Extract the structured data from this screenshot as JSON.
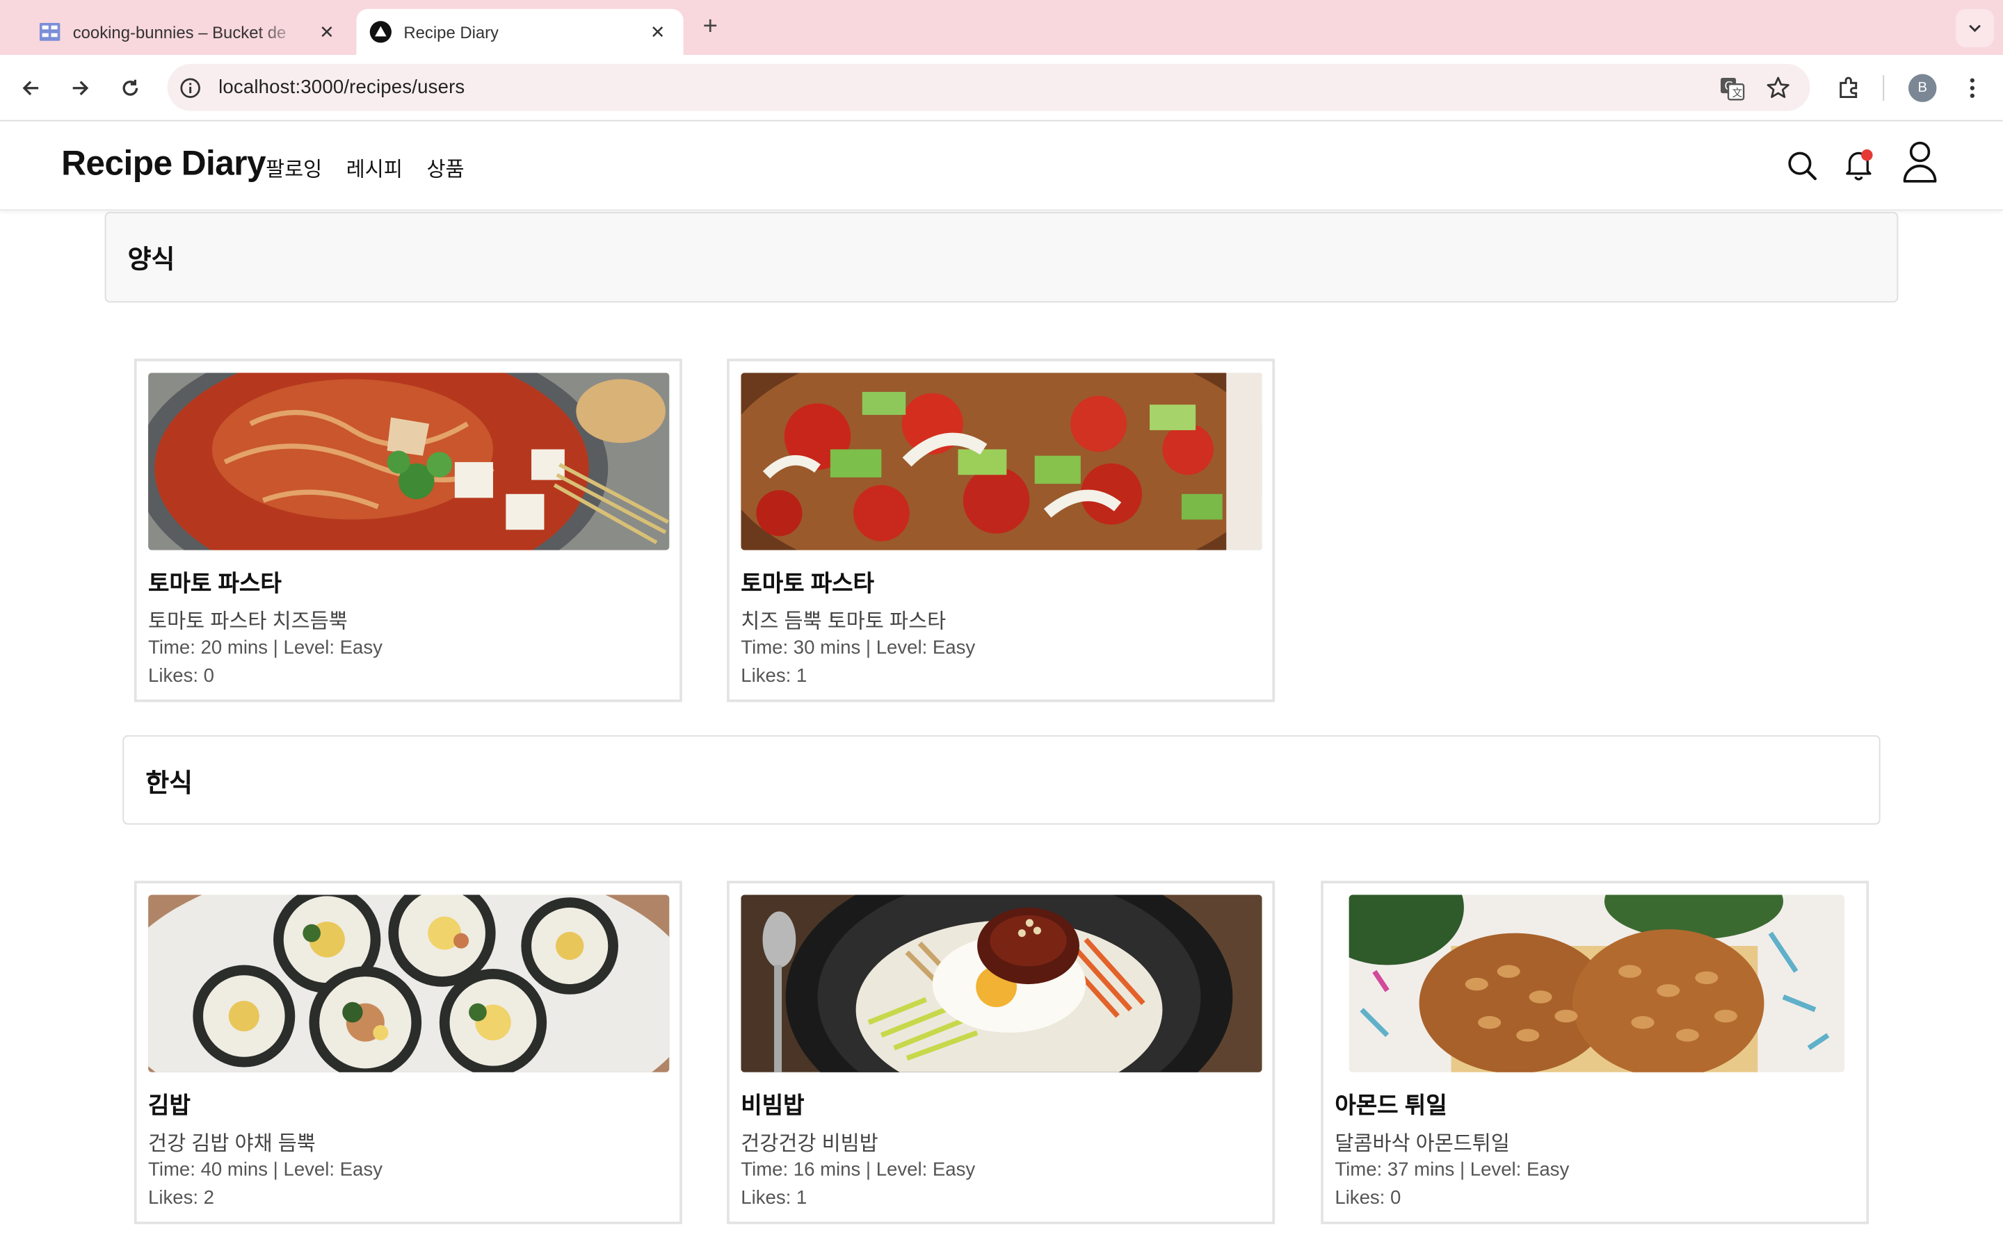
{
  "browser": {
    "tabs": [
      {
        "title": "cooking-bunnies – Bucket de",
        "icon": "bucket-icon",
        "active": false
      },
      {
        "title": "Recipe Diary",
        "icon": "site-logo-icon",
        "active": true
      }
    ],
    "url": "localhost:3000/recipes/users",
    "profile_initial": "B"
  },
  "app": {
    "brand": "Recipe Diary",
    "nav": [
      "팔로잉",
      "레시피",
      "상품"
    ],
    "icons": [
      "search-icon",
      "bell-icon",
      "user-icon"
    ],
    "notification_dot_color": "#e53935"
  },
  "sections": [
    {
      "title": "양식",
      "recipes": [
        {
          "name": "토마토 파스타",
          "desc": "토마토 파스타 치즈듬뿍",
          "meta": "Time: 20 mins | Level: Easy",
          "likes": "Likes: 0"
        },
        {
          "name": "토마토 파스타",
          "desc": "치즈 듬뿍 토마토 파스타",
          "meta": "Time: 30 mins | Level: Easy",
          "likes": "Likes: 1"
        }
      ]
    },
    {
      "title": "한식",
      "recipes": [
        {
          "name": "김밥",
          "desc": "건강 김밥 야채 듬뿍",
          "meta": "Time: 40 mins | Level: Easy",
          "likes": "Likes: 2"
        },
        {
          "name": "비빔밥",
          "desc": "건강건강 비빔밥",
          "meta": "Time: 16 mins | Level: Easy",
          "likes": "Likes: 1"
        },
        {
          "name": "아몬드 튀일",
          "desc": "달콤바삭 아몬드튀일",
          "meta": "Time: 37 mins | Level: Easy",
          "likes": "Likes: 0"
        }
      ]
    }
  ]
}
